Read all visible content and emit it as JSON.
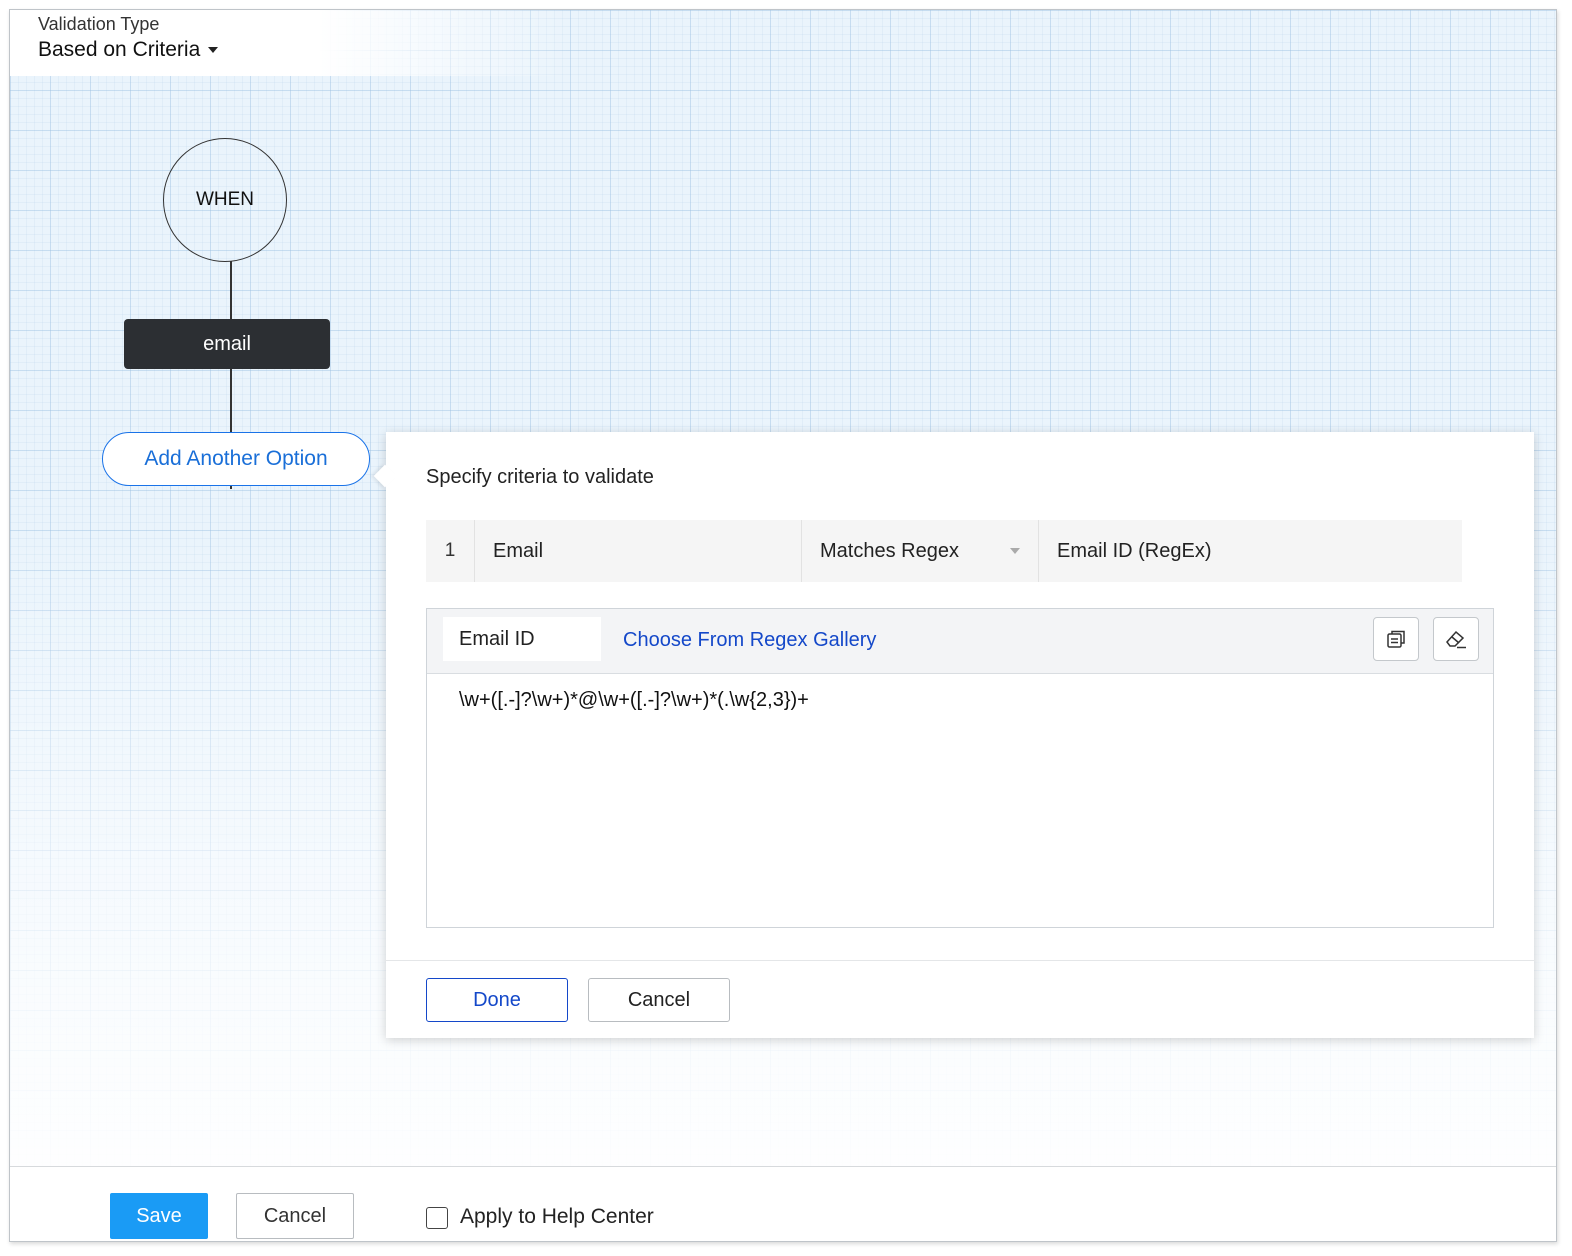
{
  "header": {
    "validation_type_label": "Validation Type",
    "validation_type_value": "Based on Criteria"
  },
  "flow": {
    "when_label": "WHEN",
    "field_node": "email",
    "add_option": "Add Another Option"
  },
  "panel": {
    "title": "Specify criteria to validate",
    "criteria": {
      "index": "1",
      "field": "Email",
      "operator": "Matches Regex",
      "value": "Email ID (RegEx)"
    },
    "regex": {
      "tab_label": "Email ID",
      "gallery_link": "Choose From Regex Gallery",
      "pattern": "\\w+([.-]?\\w+)*@\\w+([.-]?\\w+)*(.\\w{2,3})+",
      "icons": [
        "copy-icon",
        "eraser-icon"
      ]
    },
    "done_label": "Done",
    "cancel_label": "Cancel"
  },
  "footer": {
    "save_label": "Save",
    "cancel_label": "Cancel",
    "apply_label": "Apply to Help Center",
    "apply_checked": false
  },
  "colors": {
    "accent_blue": "#1a9bf5",
    "link_blue": "#1448c9",
    "node_dark": "#2c2f33"
  }
}
